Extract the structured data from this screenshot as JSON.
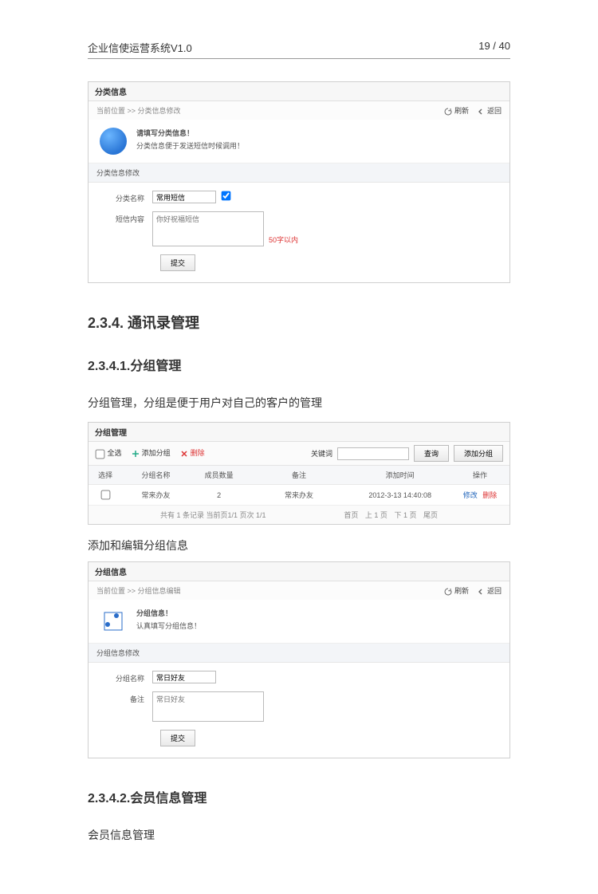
{
  "header": {
    "title": "企业信使运营系统V1.0",
    "page": "19 / 40"
  },
  "panel1": {
    "title": "分类信息",
    "breadcrumb": "当前位置 >> 分类信息修改",
    "link_refresh": "刷新",
    "link_back": "返回",
    "info_t1": "请填写分类信息！",
    "info_t2": "分类信息便于发送短信时候调用！",
    "section_bar": "分类信息修改",
    "name_label": "分类名称",
    "name_value": "常用短信",
    "textarea_ph": "你好祝福短信",
    "content_label": "短信内容",
    "limit": "50字以内",
    "submit": "提交"
  },
  "h2_234": "2.3.4. 通讯录管理",
  "h3_2341": "2.3.4.1.分组管理",
  "p_group_desc": "分组管理，分组是便于用户对自己的客户的管理",
  "panel2": {
    "title": "分组管理",
    "select_all": "全选",
    "add_group": "添加分组",
    "delete": "删除",
    "keyword_label": "关键词",
    "search_btn": "查询",
    "add_btn": "添加分组",
    "columns": [
      "选择",
      "分组名称",
      "成员数量",
      "备注",
      "添加时间",
      "操作"
    ],
    "row": {
      "name": "常来办友",
      "count": "2",
      "remark": "常来办友",
      "time": "2012-3-13 14:40:08",
      "edit": "修改",
      "del": "删除"
    },
    "footer_left": "共有 1 条记录 当前页1/1 页次 1/1",
    "footer_right": [
      "首页",
      "上 1 页",
      "下 1 页",
      "尾页"
    ]
  },
  "p_add_edit": "添加和编辑分组信息",
  "panel3": {
    "title": "分组信息",
    "breadcrumb": "当前位置 >> 分组信息编辑",
    "link_refresh": "刷新",
    "link_back": "返回",
    "info_t1": "分组信息！",
    "info_t2": "认真填写分组信息！",
    "section_bar": "分组信息修改",
    "name_label": "分组名称",
    "name_value": "常日好友",
    "textarea_ph": "常日好友",
    "remark_label": "备注",
    "submit": "提交"
  },
  "h3_2342": "2.3.4.2.会员信息管理",
  "p_member": "会员信息管理"
}
